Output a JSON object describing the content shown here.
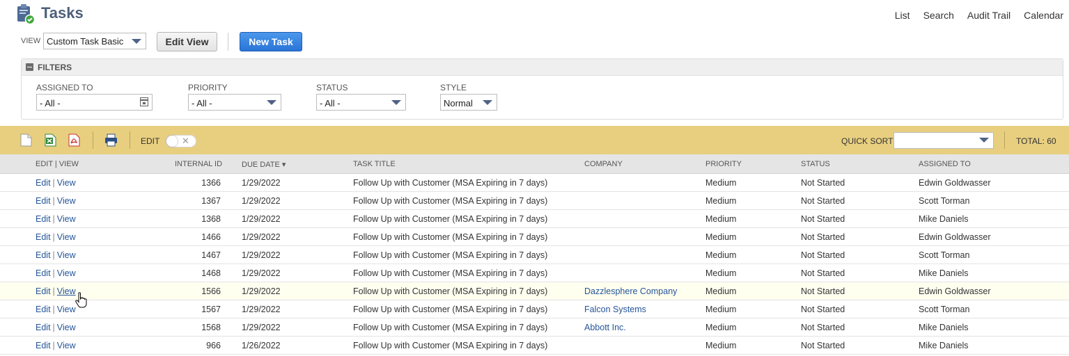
{
  "header": {
    "title": "Tasks",
    "links": [
      "List",
      "Search",
      "Audit Trail",
      "Calendar"
    ]
  },
  "view": {
    "label": "VIEW",
    "selected": "Custom Task Basic",
    "edit_view_label": "Edit View",
    "new_task_label": "New Task"
  },
  "filters": {
    "title": "FILTERS",
    "assigned_to": {
      "label": "ASSIGNED TO",
      "value": "- All -"
    },
    "priority": {
      "label": "PRIORITY",
      "value": "- All -"
    },
    "status": {
      "label": "STATUS",
      "value": "- All -"
    },
    "style": {
      "label": "STYLE",
      "value": "Normal"
    }
  },
  "toolbar": {
    "edit_label": "EDIT",
    "quick_sort_label": "QUICK SORT",
    "quick_sort_value": "",
    "total": "TOTAL: 60"
  },
  "table": {
    "columns": {
      "edit_view": "EDIT | VIEW",
      "internal_id": "INTERNAL ID",
      "due_date": "DUE DATE ▾",
      "task_title": "TASK TITLE",
      "company": "COMPANY",
      "priority": "PRIORITY",
      "status": "STATUS",
      "assigned_to": "ASSIGNED TO"
    },
    "edit_text": "Edit",
    "view_text": "View",
    "rows": [
      {
        "id": "1366",
        "due": "1/29/2022",
        "title": "Follow Up with Customer (MSA Expiring in 7 days)",
        "company": "",
        "priority": "Medium",
        "status": "Not Started",
        "assigned": "Edwin Goldwasser"
      },
      {
        "id": "1367",
        "due": "1/29/2022",
        "title": "Follow Up with Customer (MSA Expiring in 7 days)",
        "company": "",
        "priority": "Medium",
        "status": "Not Started",
        "assigned": "Scott Torman"
      },
      {
        "id": "1368",
        "due": "1/29/2022",
        "title": "Follow Up with Customer (MSA Expiring in 7 days)",
        "company": "",
        "priority": "Medium",
        "status": "Not Started",
        "assigned": "Mike Daniels"
      },
      {
        "id": "1466",
        "due": "1/29/2022",
        "title": "Follow Up with Customer (MSA Expiring in 7 days)",
        "company": "",
        "priority": "Medium",
        "status": "Not Started",
        "assigned": "Edwin Goldwasser"
      },
      {
        "id": "1467",
        "due": "1/29/2022",
        "title": "Follow Up with Customer (MSA Expiring in 7 days)",
        "company": "",
        "priority": "Medium",
        "status": "Not Started",
        "assigned": "Scott Torman"
      },
      {
        "id": "1468",
        "due": "1/29/2022",
        "title": "Follow Up with Customer (MSA Expiring in 7 days)",
        "company": "",
        "priority": "Medium",
        "status": "Not Started",
        "assigned": "Mike Daniels"
      },
      {
        "id": "1566",
        "due": "1/29/2022",
        "title": "Follow Up with Customer (MSA Expiring in 7 days)",
        "company": "Dazzlesphere Company",
        "priority": "Medium",
        "status": "Not Started",
        "assigned": "Edwin Goldwasser"
      },
      {
        "id": "1567",
        "due": "1/29/2022",
        "title": "Follow Up with Customer (MSA Expiring in 7 days)",
        "company": "Falcon Systems",
        "priority": "Medium",
        "status": "Not Started",
        "assigned": "Scott Torman"
      },
      {
        "id": "1568",
        "due": "1/29/2022",
        "title": "Follow Up with Customer (MSA Expiring in 7 days)",
        "company": "Abbott Inc.",
        "priority": "Medium",
        "status": "Not Started",
        "assigned": "Mike Daniels"
      },
      {
        "id": "966",
        "due": "1/26/2022",
        "title": "Follow Up with Customer (MSA Expiring in 7 days)",
        "company": "",
        "priority": "Medium",
        "status": "Not Started",
        "assigned": "Mike Daniels"
      }
    ]
  },
  "colors": {
    "toolbar_bg": "#e8cf80",
    "link": "#255599",
    "primary_button": "#2a74d6",
    "title": "#4d5f79"
  }
}
